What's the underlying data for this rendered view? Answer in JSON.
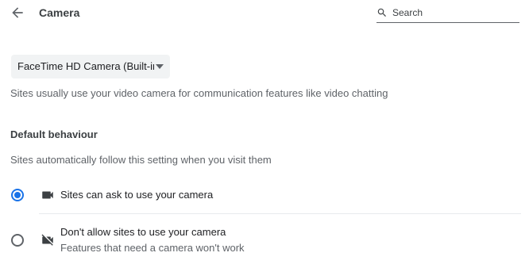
{
  "header": {
    "title": "Camera",
    "search_placeholder": "Search",
    "back_icon": "arrow-back-icon",
    "search_icon": "search-icon"
  },
  "camera_select": {
    "selected": "FaceTime HD Camera (Built-in)",
    "arrow_icon": "dropdown-arrow-icon"
  },
  "description": "Sites usually use your video camera for communication features like video chatting",
  "default_behaviour": {
    "heading": "Default behaviour",
    "subtitle": "Sites automatically follow this setting when you visit them",
    "options": [
      {
        "label": "Sites can ask to use your camera",
        "icon": "videocam-icon",
        "checked": true
      },
      {
        "label": "Don't allow sites to use your camera",
        "sublabel": "Features that need a camera won't work",
        "icon": "videocam-off-icon",
        "checked": false
      }
    ]
  },
  "colors": {
    "accent": "#1a73e8",
    "text_primary": "#202124",
    "text_secondary": "#5f6368",
    "select_bg": "#f1f3f4",
    "divider": "#e8eaed"
  }
}
